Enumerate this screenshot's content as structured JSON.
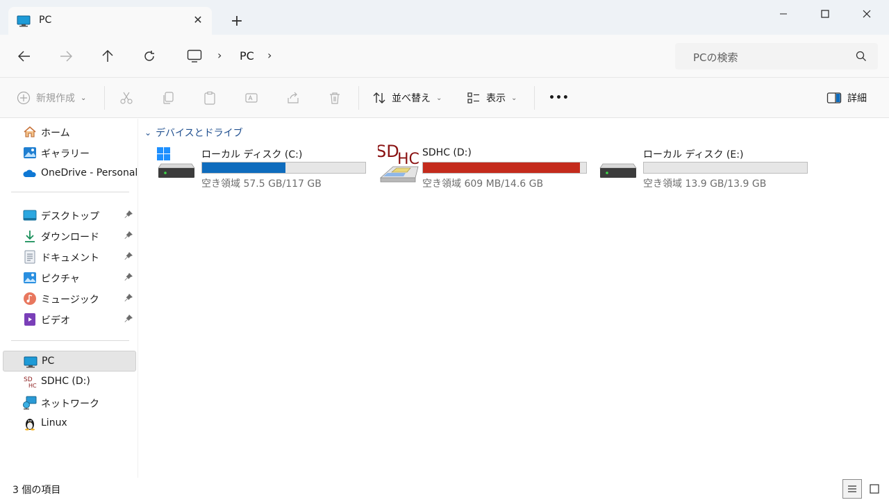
{
  "window": {
    "tab_title": "PC",
    "tab_close_glyph": "✕",
    "new_tab_glyph": "+",
    "minimize": "minimize-icon",
    "maximize": "maximize-icon",
    "close": "close-icon"
  },
  "address": {
    "crumbs": [
      "PC"
    ],
    "search_placeholder": "PCの検索"
  },
  "commands": {
    "new": "新規作成",
    "sort": "並べ替え",
    "view": "表示",
    "more": "•••",
    "details": "詳細"
  },
  "sidebar": {
    "quick": [
      {
        "label": "ホーム",
        "icon": "home-icon"
      },
      {
        "label": "ギャラリー",
        "icon": "gallery-icon"
      },
      {
        "label": "OneDrive - Personal",
        "icon": "onedrive-icon"
      }
    ],
    "pinned": [
      {
        "label": "デスクトップ",
        "icon": "desktop-icon"
      },
      {
        "label": "ダウンロード",
        "icon": "download-icon"
      },
      {
        "label": "ドキュメント",
        "icon": "document-icon"
      },
      {
        "label": "ピクチャ",
        "icon": "pictures-icon"
      },
      {
        "label": "ミュージック",
        "icon": "music-icon"
      },
      {
        "label": "ビデオ",
        "icon": "video-icon"
      }
    ],
    "locations": [
      {
        "label": "PC",
        "icon": "pc-icon",
        "selected": true
      },
      {
        "label": "SDHC (D:)",
        "icon": "sdhc-icon"
      },
      {
        "label": "ネットワーク",
        "icon": "network-icon"
      },
      {
        "label": "Linux",
        "icon": "linux-icon"
      }
    ]
  },
  "content": {
    "group_title": "デバイスとドライブ",
    "drives": [
      {
        "name": "ローカル ディスク (C:)",
        "space": "空き領域 57.5 GB/117 GB",
        "used_fraction": 0.51,
        "bar_color": "#0f6cbd",
        "icon": "windows-drive-icon"
      },
      {
        "name": "SDHC (D:)",
        "space": "空き領域 609 MB/14.6 GB",
        "used_fraction": 0.96,
        "bar_color": "#c42b1c",
        "icon": "sdhc-card-icon",
        "icon_text_top": "SD",
        "icon_text_bottom": "HC"
      },
      {
        "name": "ローカル ディスク (E:)",
        "space": "空き領域 13.9 GB/13.9 GB",
        "used_fraction": 0.0,
        "bar_color": "#0f6cbd",
        "icon": "local-drive-icon"
      }
    ]
  },
  "status": {
    "item_count": "3 個の項目"
  },
  "colors": {
    "accent": "#0f6cbd",
    "danger": "#c42b1c",
    "group_header": "#1f4f8f"
  }
}
